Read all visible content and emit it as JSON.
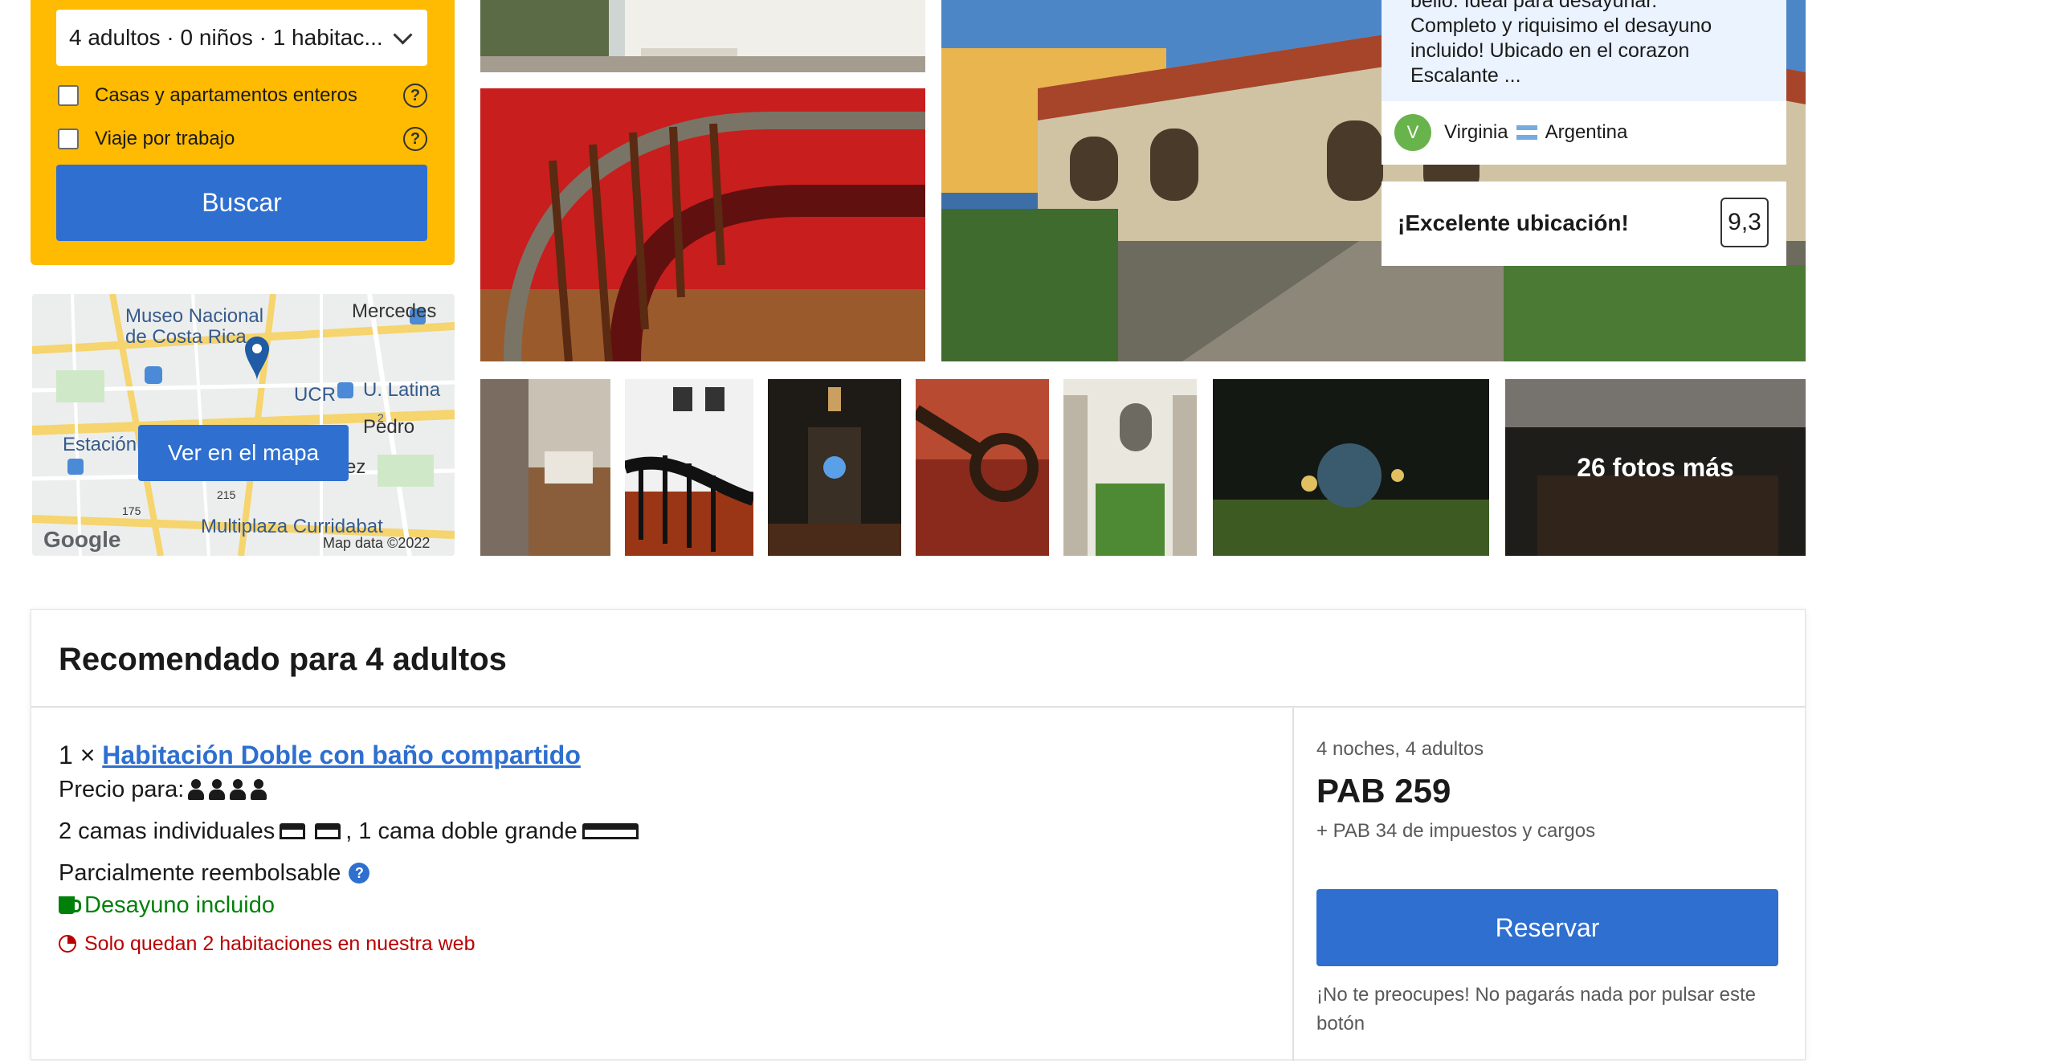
{
  "search": {
    "guests_summary": "4 adultos · 0 niños · 1 habitac...",
    "options": [
      {
        "label": "Casas y apartamentos enteros",
        "checked": false,
        "help": "?"
      },
      {
        "label": "Viaje por trabajo",
        "checked": false,
        "help": "?"
      }
    ],
    "search_button": "Buscar"
  },
  "map": {
    "labels": [
      "Museo Nacional",
      "de Costa Rica",
      "Mercedes",
      "UCR",
      "U. Latina",
      "Pedro",
      "Estación",
      "Multiplaza Curridabat",
      "Map data ©2022",
      "Google",
      "175",
      "215",
      "2",
      "ez"
    ],
    "button": "Ver en el mapa"
  },
  "gallery": {
    "more_photos": "26 fotos más"
  },
  "review": {
    "lines": [
      "bello. Ideal para desayunar.",
      "Completo y riquisimo el desayuno",
      "incluido! Ubicado en el corazon",
      "Escalante ..."
    ],
    "reviewer_initial": "V",
    "reviewer_name": "Virginia",
    "reviewer_country": "Argentina"
  },
  "location_highlight": {
    "title": "¡Excelente ubicación!",
    "score": "9,3"
  },
  "recommendation": {
    "title": "Recomendado para 4 adultos",
    "room_quantity": "1 ×",
    "room_name": "Habitación Doble con baño compartido",
    "price_for_label": "Precio para:",
    "guests_count": 4,
    "beds_single": "2 camas individuales",
    "beds_separator": ",",
    "beds_double": "1 cama doble grande",
    "refund_policy": "Parcialmente reembolsable",
    "breakfast": "Desayuno incluido",
    "scarcity": "Solo quedan 2 habitaciones en nuestra web",
    "stay_summary": "4 noches, 4 adultos",
    "price": "PAB 259",
    "taxes": "+ PAB 34 de impuestos y cargos",
    "reserve_button": "Reservar",
    "reserve_note": "¡No te preocupes! No pagarás nada por pulsar este botón"
  },
  "colors": {
    "search_bg": "#febb02",
    "primary": "#2e6fcf",
    "success": "#008009",
    "urgent": "#b80000"
  }
}
